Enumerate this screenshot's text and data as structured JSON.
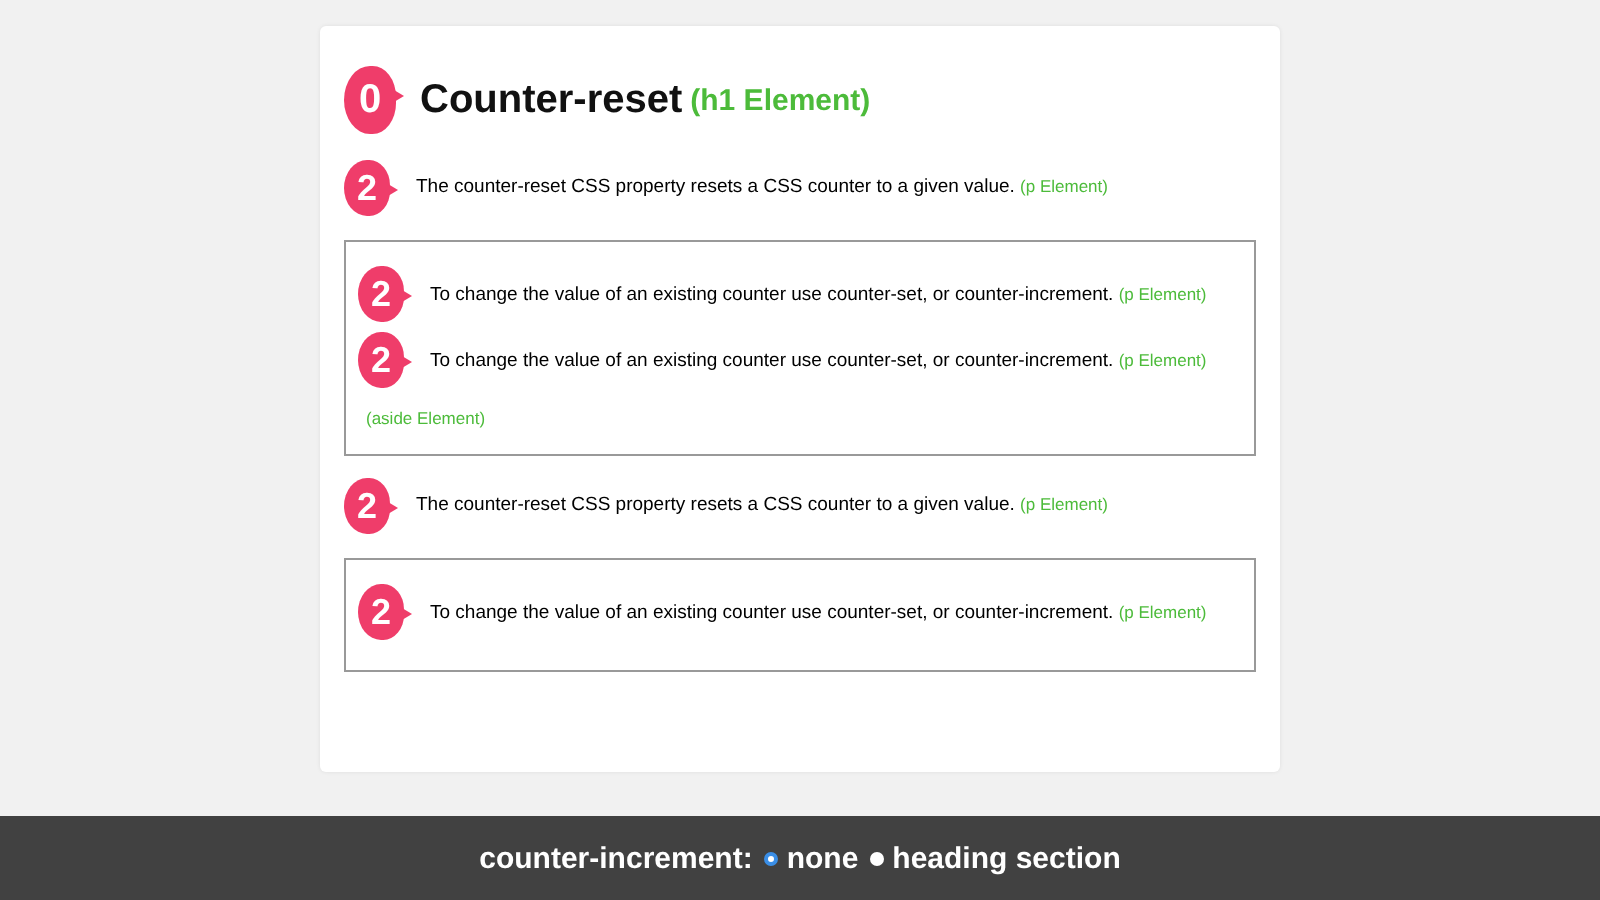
{
  "heading": {
    "counter": "0",
    "title": "Counter-reset",
    "tag": "(h1 Element)"
  },
  "sections": [
    {
      "paragraph": {
        "counter": "2",
        "text": "The counter-reset CSS property resets a CSS counter to a given value.",
        "tag": "(p Element)"
      },
      "aside": {
        "paragraphs": [
          {
            "counter": "2",
            "text": "To change the value of an existing counter use counter-set, or counter-increment.",
            "tag": "(p Element)"
          },
          {
            "counter": "2",
            "text": "To change the value of an existing counter use counter-set, or counter-increment.",
            "tag": "(p Element)"
          }
        ],
        "tag": "(aside Element)"
      }
    },
    {
      "paragraph": {
        "counter": "2",
        "text": "The counter-reset CSS property resets a CSS counter to a given value.",
        "tag": "(p Element)"
      },
      "aside": {
        "paragraphs": [
          {
            "counter": "2",
            "text": "To change the value of an existing counter use counter-set, or counter-increment.",
            "tag": "(p Element)"
          }
        ]
      }
    }
  ],
  "control_bar": {
    "label": "counter-increment:",
    "options": [
      {
        "label": "none",
        "selected": true
      },
      {
        "label": "heading section",
        "selected": false
      }
    ]
  }
}
